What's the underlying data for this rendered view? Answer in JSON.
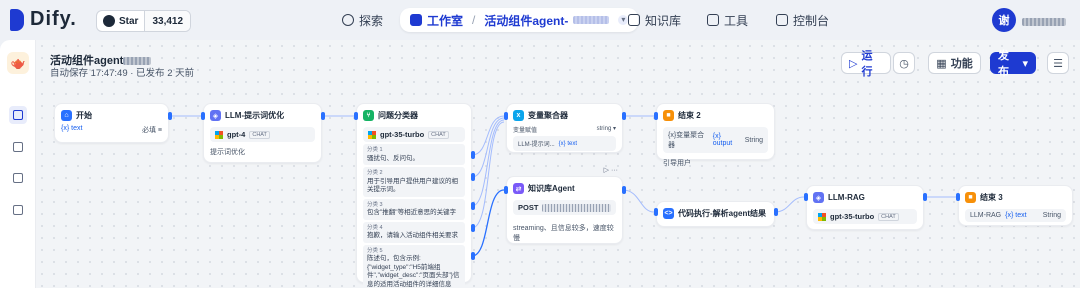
{
  "brand": {
    "name": "Dify."
  },
  "github": {
    "star_label": "Star",
    "count": "33,412"
  },
  "nav": {
    "explore": "探索",
    "studio": "工作室",
    "app_name": "活动组件agent-",
    "knowledge": "知识库",
    "tools": "工具",
    "console": "控制台"
  },
  "user": {
    "avatar_char": "谢"
  },
  "app": {
    "title": "活动组件agent",
    "status": "自动保存 17:47:49 · 已发布 2 天前"
  },
  "toolbar": {
    "run": "运行",
    "features": "功能",
    "publish": "发布"
  },
  "nodes": {
    "start": {
      "title": "开始",
      "var": "{x} text",
      "required": "必填"
    },
    "llm1": {
      "title": "LLM-提示词优化",
      "model": "gpt-4",
      "tag": "CHAT",
      "desc": "提示词优化"
    },
    "classifier": {
      "title": "问题分类器",
      "model": "gpt-35-turbo",
      "tag": "CHAT",
      "classes": [
        {
          "label": "分类 1",
          "text": "骚扰句、反问句。"
        },
        {
          "label": "分类 2",
          "text": "用于引导用户提供用户建议的相关提示词。"
        },
        {
          "label": "分类 3",
          "text": "包含\"推翻\"等相近意思的关键字"
        },
        {
          "label": "分类 4",
          "text": "抱歉，请输入活动组件相关要求"
        },
        {
          "label": "分类 5",
          "text": "陈述句，包含示例: {\"widget_type\":\"H5前端组件\",\"widget_desc\":\"页面头部\"}信息的适用活动组件的详细信息"
        }
      ]
    },
    "aggregator": {
      "title": "变量聚合器",
      "col_var": "变量赋值",
      "col_type": "string",
      "row_src": "LLM-提示词...",
      "row_var": "{x} text"
    },
    "end2": {
      "title": "结束 2",
      "var_src": "{x}变量聚合器",
      "var_name": "{x} output",
      "var_type": "String",
      "desc": "引导用户"
    },
    "knowledge": {
      "title": "知识库Agent",
      "method": "POST",
      "desc": "streaming、且信息较多，速度较慢"
    },
    "code": {
      "title": "代码执行-解析agent结果"
    },
    "llm_rag": {
      "title": "LLM-RAG",
      "model": "gpt-35-turbo",
      "tag": "CHAT"
    },
    "end3": {
      "title": "结束 3",
      "var_src": "LLM-RAG",
      "var_name": "{x} text",
      "var_type": "String"
    }
  },
  "colors": {
    "accent": "#1e3ad1",
    "edge": "#2970ff"
  }
}
